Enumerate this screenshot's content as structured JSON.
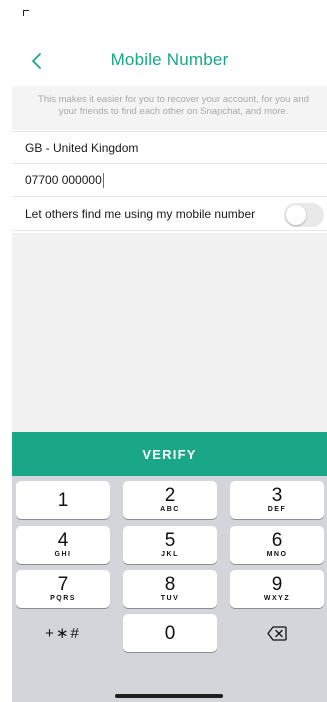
{
  "header": {
    "title": "Mobile Number",
    "back_icon": "chevron-left-icon"
  },
  "info_text": "This makes it easier for you to recover your account, for you and your friends to find each other on Snapchat, and more.",
  "form": {
    "country_value": "GB - United Kingdom",
    "phone_value": "07700 000000",
    "toggle_label": "Let others find me using my mobile number",
    "toggle_on": false
  },
  "verify_label": "VERIFY",
  "keypad": {
    "k1": {
      "digit": "1",
      "letters": ""
    },
    "k2": {
      "digit": "2",
      "letters": "ABC"
    },
    "k3": {
      "digit": "3",
      "letters": "DEF"
    },
    "k4": {
      "digit": "4",
      "letters": "GHI"
    },
    "k5": {
      "digit": "5",
      "letters": "JKL"
    },
    "k6": {
      "digit": "6",
      "letters": "MNO"
    },
    "k7": {
      "digit": "7",
      "letters": "PQRS"
    },
    "k8": {
      "digit": "8",
      "letters": "TUV"
    },
    "k9": {
      "digit": "9",
      "letters": "WXYZ"
    },
    "k0": {
      "digit": "0"
    },
    "symbols": "+∗#",
    "delete_icon": "backspace-icon"
  },
  "colors": {
    "accent": "#1aa787",
    "keyboard_bg": "#d3d5da",
    "info_bg": "#f4f4f4"
  }
}
